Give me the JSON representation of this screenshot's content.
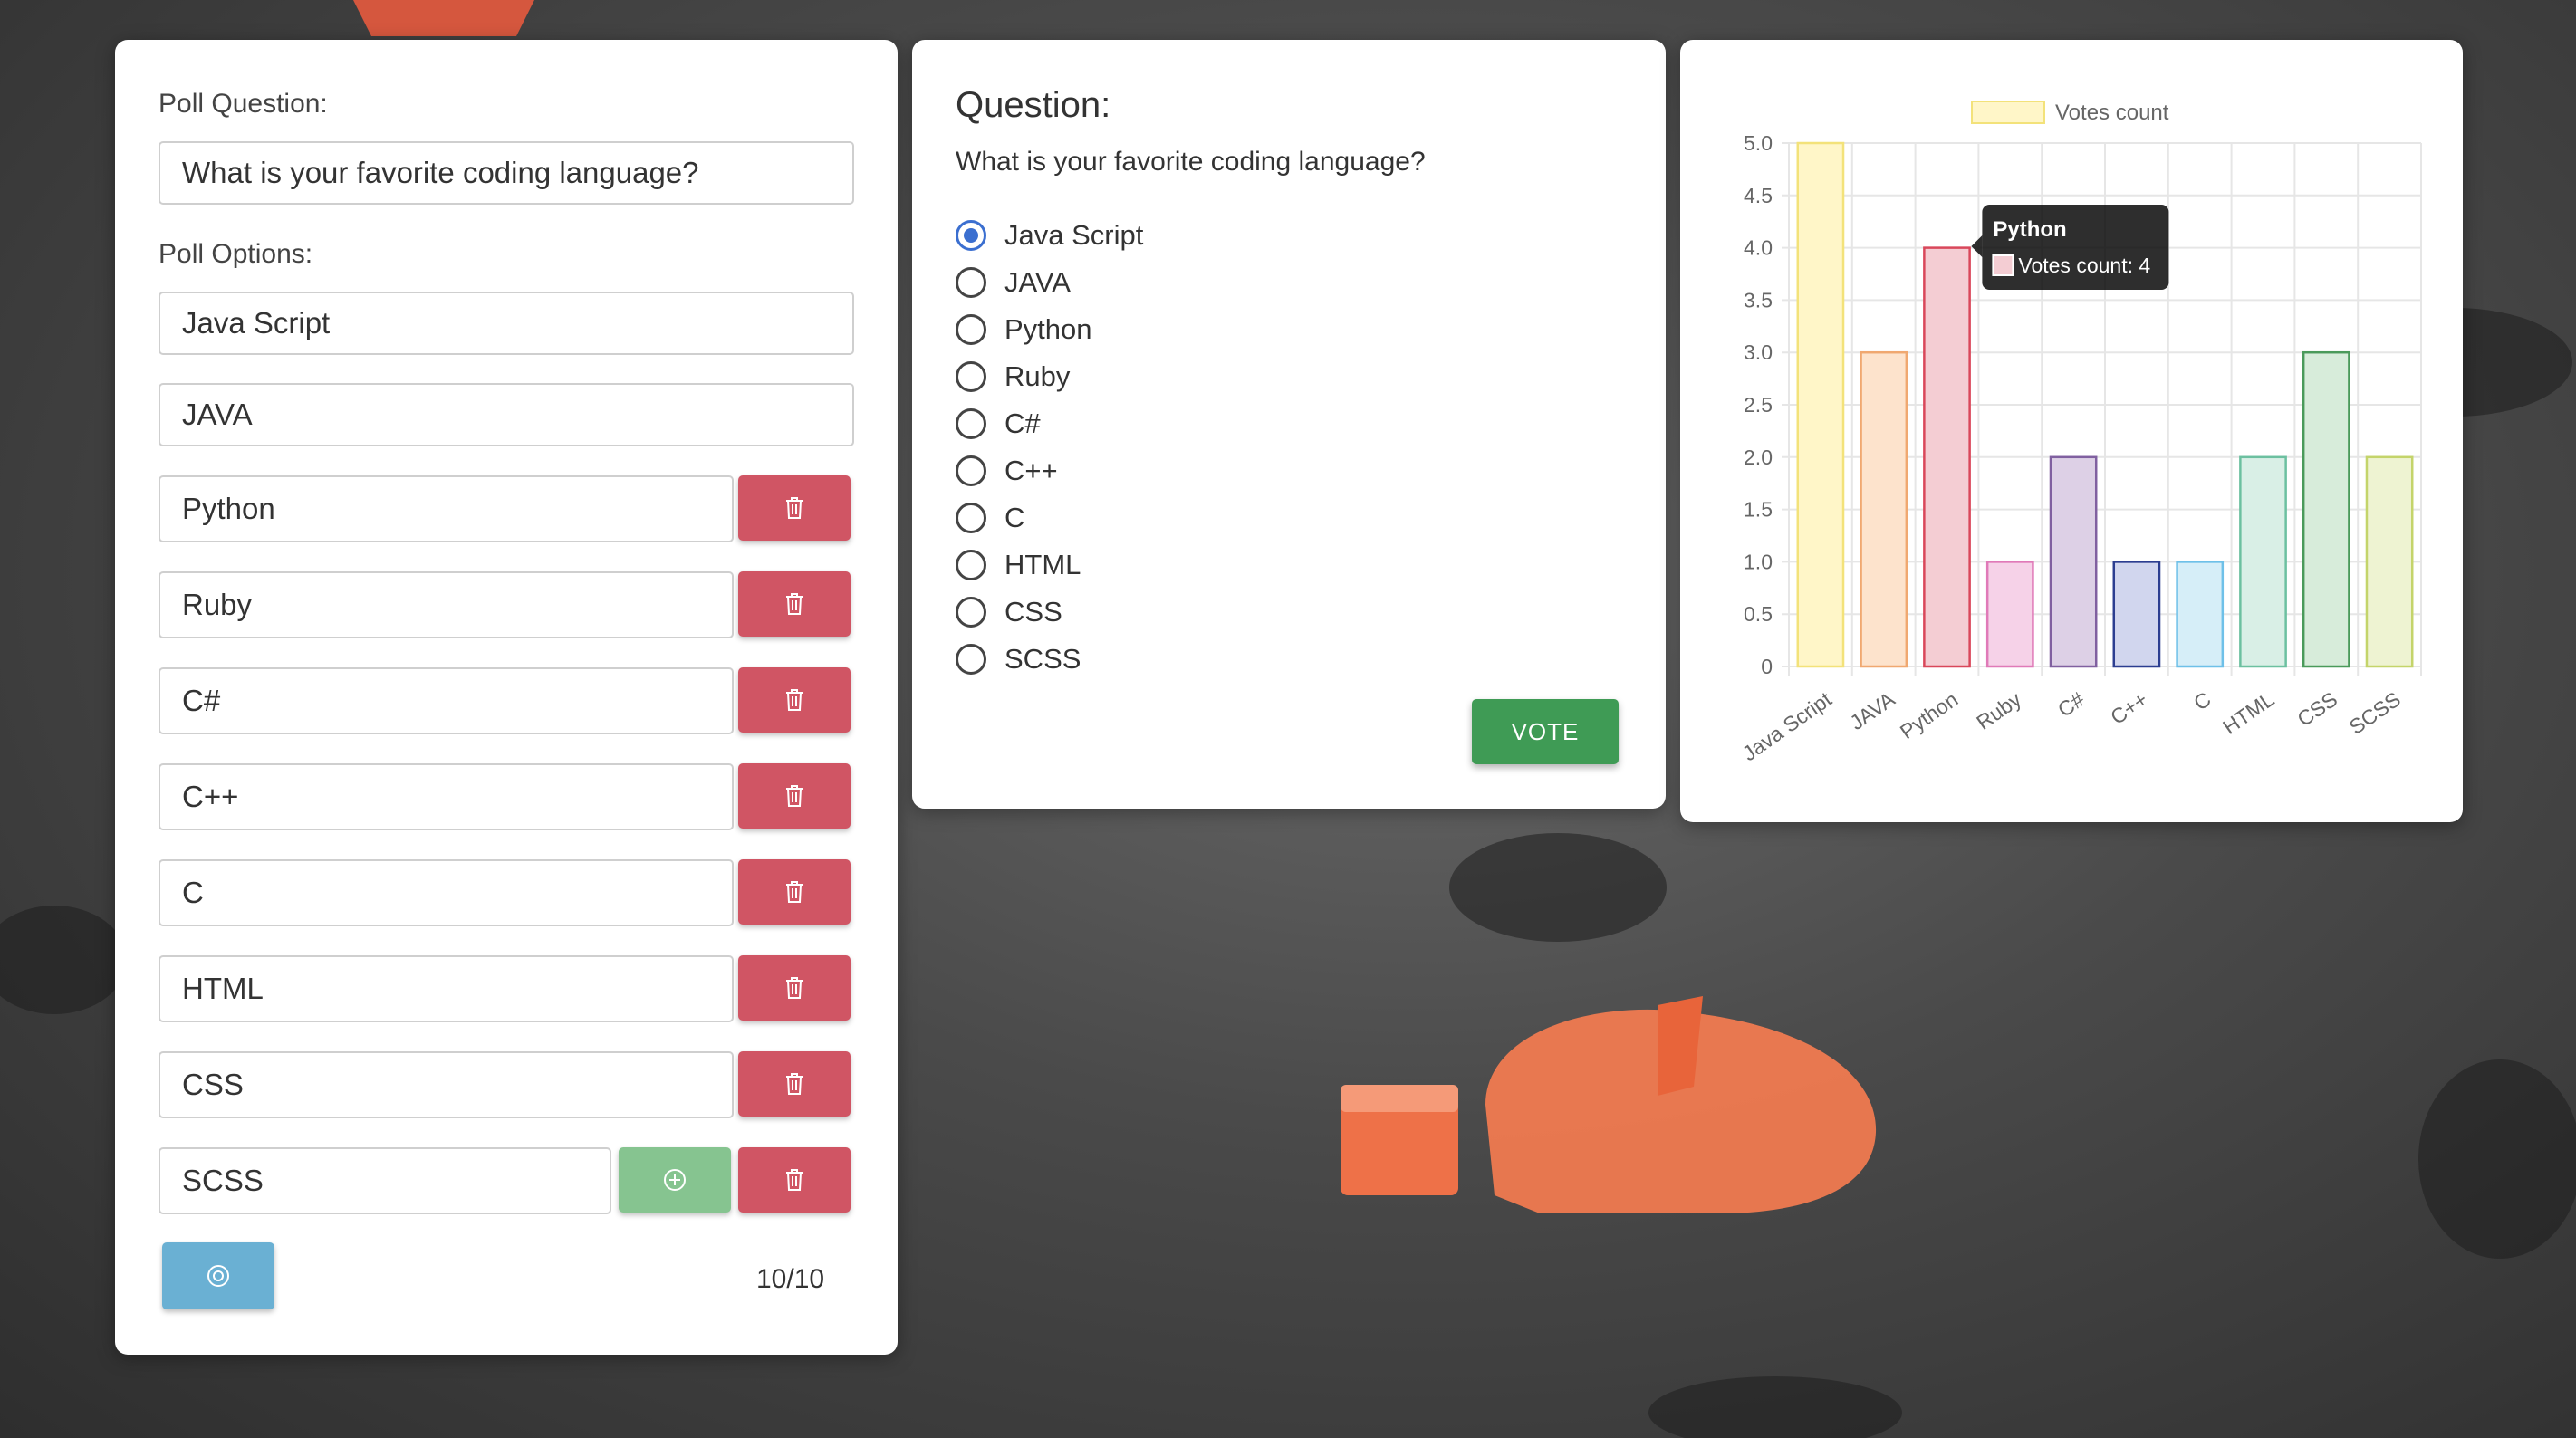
{
  "editor": {
    "question_label": "Poll Question:",
    "question_value": "What is your favorite coding language?",
    "options_label": "Poll Options:",
    "options": [
      "Java Script",
      "JAVA",
      "Python",
      "Ruby",
      "C#",
      "C++",
      "C",
      "HTML",
      "CSS",
      "SCSS"
    ],
    "counter": "10/10"
  },
  "preview": {
    "title": "Question:",
    "question": "What is your favorite coding language?",
    "options": [
      {
        "label": "Java Script",
        "checked": true
      },
      {
        "label": "JAVA",
        "checked": false
      },
      {
        "label": "Python",
        "checked": false
      },
      {
        "label": "Ruby",
        "checked": false
      },
      {
        "label": "C#",
        "checked": false
      },
      {
        "label": "C++",
        "checked": false
      },
      {
        "label": "C",
        "checked": false
      },
      {
        "label": "HTML",
        "checked": false
      },
      {
        "label": "CSS",
        "checked": false
      },
      {
        "label": "SCSS",
        "checked": false
      }
    ],
    "vote_label": "VOTE"
  },
  "tooltip": {
    "title": "Python",
    "label": "Votes count: 4"
  },
  "chart_data": {
    "type": "bar",
    "categories": [
      "Java Script",
      "JAVA",
      "Python",
      "Ruby",
      "C#",
      "C++",
      "C",
      "HTML",
      "CSS",
      "SCSS"
    ],
    "series": [
      {
        "name": "Votes count",
        "values": [
          5,
          3,
          4,
          1,
          2,
          1,
          1,
          2,
          3,
          2
        ]
      }
    ],
    "ylim": [
      0,
      5
    ],
    "yticks": [
      "0",
      "0.5",
      "1.0",
      "1.5",
      "2.0",
      "2.5",
      "3.0",
      "3.5",
      "4.0",
      "4.5",
      "5.0"
    ],
    "grid": true,
    "legend": "top",
    "colors": {
      "fills": [
        "#fff6c8",
        "#fde3cc",
        "#f4cdd3",
        "#f6d2e8",
        "#ddd0e6",
        "#d1d6ee",
        "#d6eef8",
        "#d9efe6",
        "#d7ecda",
        "#eef3d2"
      ],
      "borders": [
        "#f3e27a",
        "#f0a870",
        "#d9475a",
        "#e07ab8",
        "#8060a0",
        "#2c3e90",
        "#6ec0e8",
        "#6cc0a0",
        "#4a9a5a",
        "#c4d46a"
      ]
    }
  }
}
